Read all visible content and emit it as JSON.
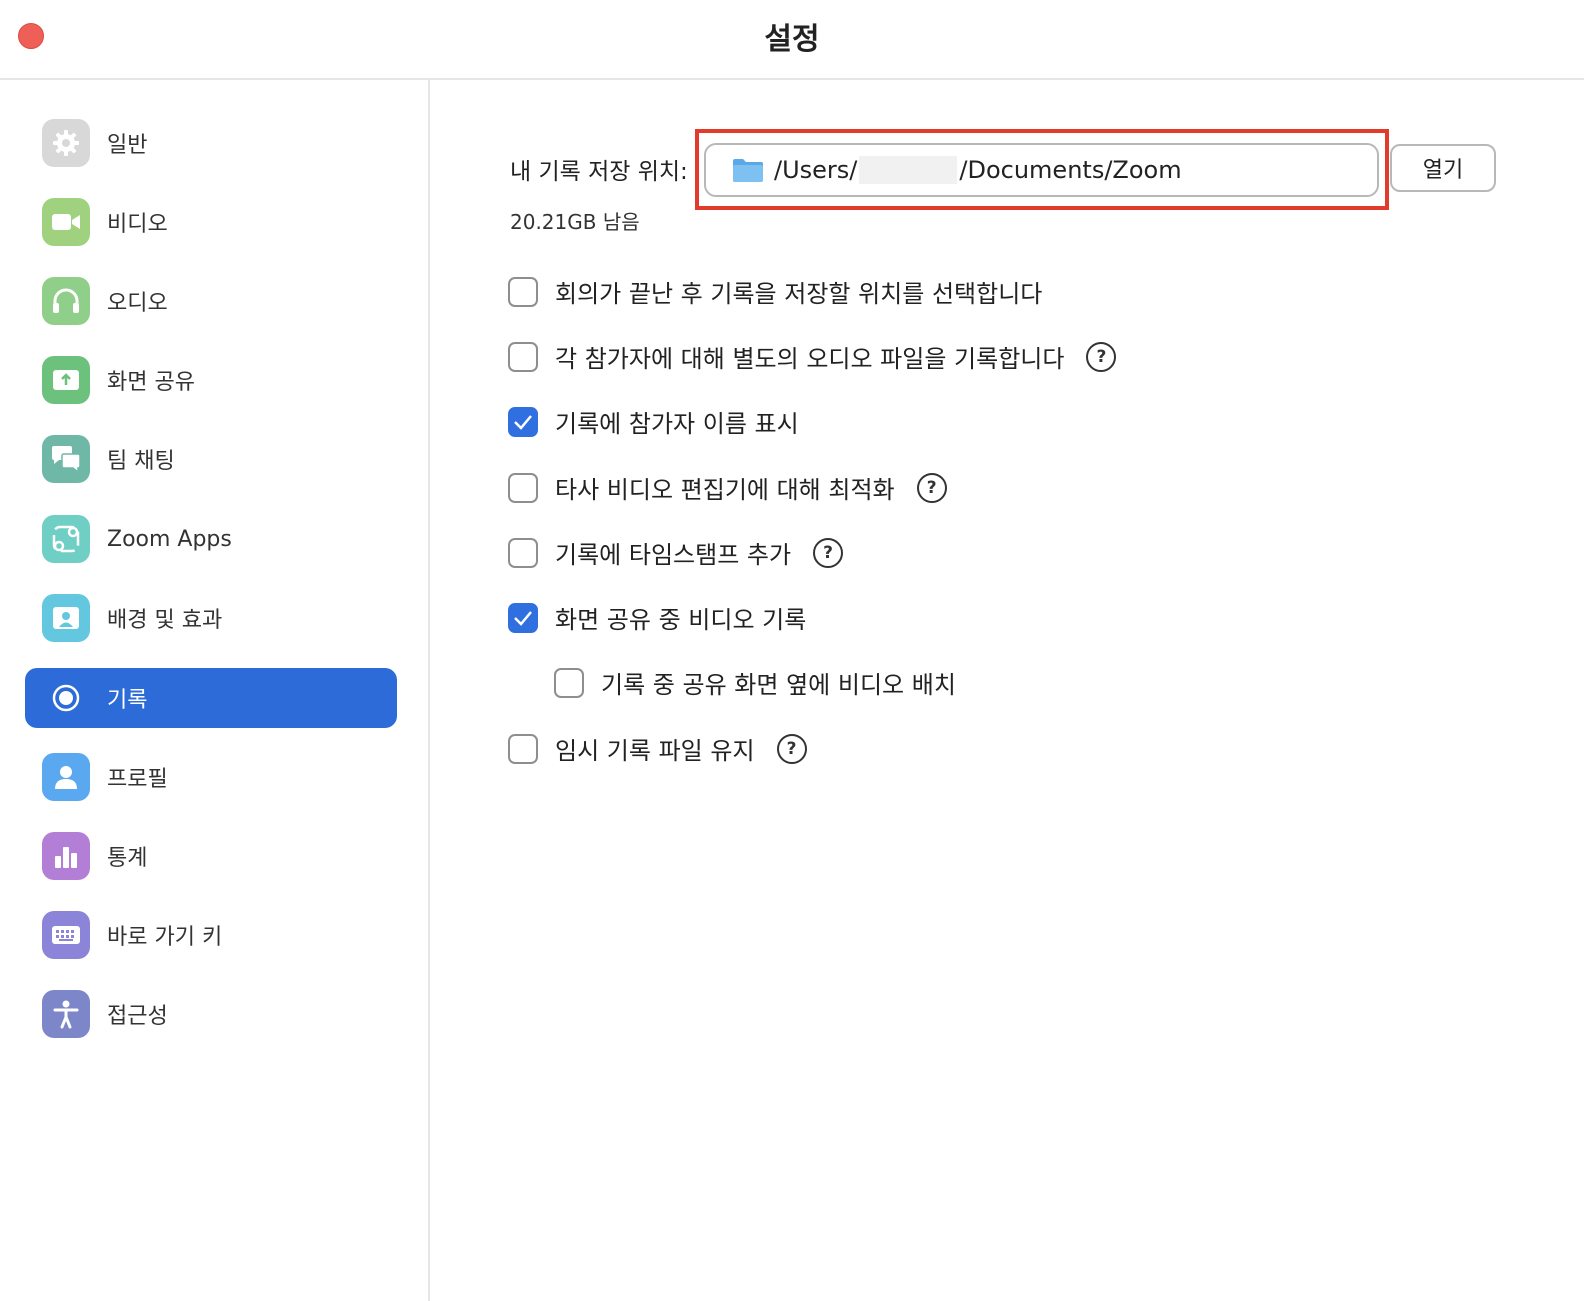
{
  "window": {
    "title": "설정"
  },
  "sidebar": {
    "items": [
      {
        "label": "일반",
        "icon": "gear-icon",
        "color": "#d8d8d8",
        "active": false
      },
      {
        "label": "비디오",
        "icon": "video-camera-icon",
        "color": "#9fd17f",
        "active": false
      },
      {
        "label": "오디오",
        "icon": "headphones-icon",
        "color": "#8fcf8a",
        "active": false
      },
      {
        "label": "화면 공유",
        "icon": "share-screen-icon",
        "color": "#6cc17c",
        "active": false
      },
      {
        "label": "팀 채팅",
        "icon": "chat-bubbles-icon",
        "color": "#6fb8a8",
        "active": false
      },
      {
        "label": "Zoom Apps",
        "icon": "apps-icon",
        "color": "#6fcfc4",
        "active": false
      },
      {
        "label": "배경 및 효과",
        "icon": "background-portrait-icon",
        "color": "#63c7df",
        "active": false
      },
      {
        "label": "기록",
        "icon": "record-icon",
        "color": "#2d6bd8",
        "active": true
      },
      {
        "label": "프로필",
        "icon": "person-icon",
        "color": "#5aa8f0",
        "active": false
      },
      {
        "label": "통계",
        "icon": "bar-chart-icon",
        "color": "#b37fd6",
        "active": false
      },
      {
        "label": "바로 가기 키",
        "icon": "keyboard-icon",
        "color": "#8b84d9",
        "active": false
      },
      {
        "label": "접근성",
        "icon": "accessibility-icon",
        "color": "#7d86c9",
        "active": false
      }
    ]
  },
  "recording": {
    "location_label": "내 기록 저장 위치:",
    "path_prefix": "/Users/",
    "path_suffix": "/Documents/Zoom",
    "open_button": "열기",
    "free_space": "20.21GB 남음",
    "options": [
      {
        "label": "회의가 끝난 후 기록을 저장할 위치를 선택합니다",
        "checked": false,
        "help": false,
        "indent": false
      },
      {
        "label": "각 참가자에 대해 별도의 오디오 파일을 기록합니다",
        "checked": false,
        "help": true,
        "indent": false
      },
      {
        "label": "기록에 참가자 이름 표시",
        "checked": true,
        "help": false,
        "indent": false
      },
      {
        "label": "타사 비디오 편집기에 대해 최적화",
        "checked": false,
        "help": true,
        "indent": false
      },
      {
        "label": "기록에 타임스탬프 추가",
        "checked": false,
        "help": true,
        "indent": false
      },
      {
        "label": "화면 공유 중 비디오 기록",
        "checked": true,
        "help": false,
        "indent": false
      },
      {
        "label": "기록 중 공유 화면 옆에 비디오 배치",
        "checked": false,
        "help": false,
        "indent": true
      },
      {
        "label": "임시 기록 파일 유지",
        "checked": false,
        "help": true,
        "indent": false
      }
    ],
    "help_glyph": "?"
  },
  "colors": {
    "accent": "#2d6bd8",
    "highlight_border": "#e23b2c",
    "close_button": "#ee5f57"
  }
}
